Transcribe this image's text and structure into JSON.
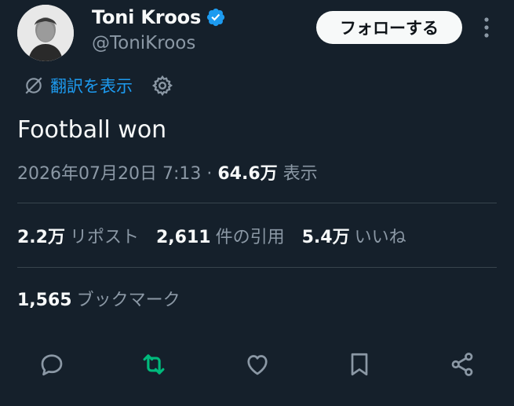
{
  "author": {
    "name": "Toni Kroos",
    "handle": "@ToniKroos",
    "verified": true
  },
  "follow_label": "フォローする",
  "translate_label": "翻訳を表示",
  "tweet_text": "Football won",
  "meta": {
    "datetime": "2026年07月20日 7:13",
    "separator": "·",
    "views": "64.6万",
    "views_label": "表示"
  },
  "stats": {
    "reposts": "2.2万",
    "reposts_label": "リポスト",
    "quotes": "2,611",
    "quotes_label": "件の引用",
    "likes": "5.4万",
    "likes_label": "いいね"
  },
  "bookmarks": {
    "count": "1,565",
    "label": "ブックマーク"
  },
  "colors": {
    "background": "#15202b",
    "accent": "#1d9bf0",
    "repost_active": "#00ba7c",
    "secondary_text": "#8b98a5"
  },
  "icons": [
    "verified-badge-icon",
    "more-icon",
    "translate-icon",
    "gear-icon",
    "reply-icon",
    "repost-icon",
    "like-icon",
    "bookmark-icon",
    "share-icon"
  ]
}
